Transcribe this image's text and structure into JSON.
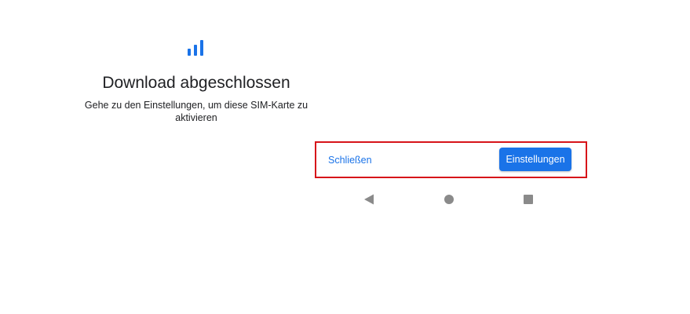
{
  "dialog": {
    "icon": "signal-bars-icon",
    "title": "Download abgeschlossen",
    "message": "Gehe zu den Einstellungen, um diese SIM-Karte zu aktivieren"
  },
  "actions": {
    "close_label": "Schließen",
    "settings_label": "Einstellungen"
  },
  "navigation": {
    "back_icon": "back-triangle-icon",
    "home_icon": "home-circle-icon",
    "recents_icon": "recents-square-icon"
  },
  "colors": {
    "accent": "#1a73e8",
    "highlight_border": "#d7141a",
    "nav_icon": "#8a8a8a",
    "text": "#202124"
  }
}
